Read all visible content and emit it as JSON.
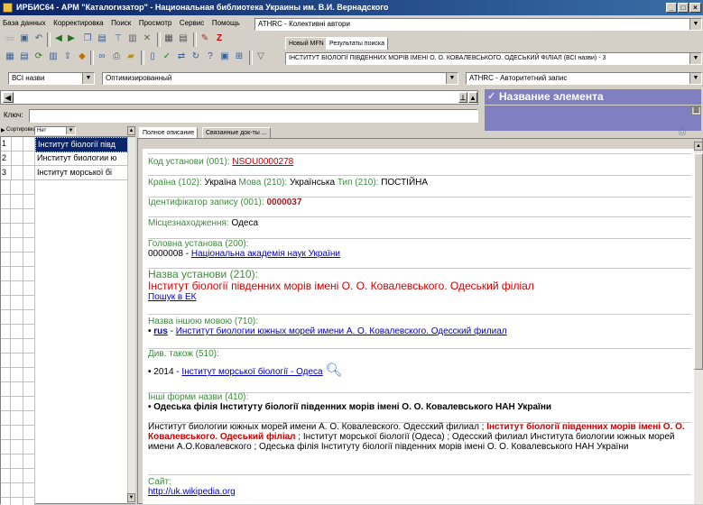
{
  "window": {
    "title": "ИРБИС64 - АРМ \"Каталогизатор\" - Национальная библиотека Украины им. В.И. Вернадского",
    "controls": [
      "_",
      "□",
      "×"
    ]
  },
  "menu": [
    "База данных",
    "Корректировка",
    "Поиск",
    "Просмотр",
    "Сервис",
    "Помощь"
  ],
  "database_combo": "ATHRC - Колективні автори",
  "toolbar1_icons": [
    "new-doc-icon",
    "save-icon",
    "undo-icon",
    "back-icon",
    "forward-icon",
    "copy-icon",
    "paste-icon",
    "filter-icon",
    "delete-icon",
    "cut-icon",
    "add-icon",
    "close-red-icon"
  ],
  "tabs_top": [
    "Новый MFN",
    "Результаты поиска"
  ],
  "search_result_combo": "ІНСТИТУТ БІОЛОГІЇ ПІВДЕННИХ МОРІВ ІМЕНІ О. О. КОВАЛЕВСЬКОГО. ОДЕСЬКИЙ ФІЛІАЛ (ВСІ назви) - 3",
  "names_combo": "ВСІ назви",
  "mode_combo": "Оптимизированный",
  "worksheet_combo": "ATHRC - Авторитетний запис",
  "element_panel_title": "Название элемента",
  "key_label": "Ключ:",
  "key_value": "",
  "sort": {
    "label": "Сортировка",
    "value": "Нет"
  },
  "grid_rows": [
    {
      "n": "1",
      "name": "Інститут біології півд"
    },
    {
      "n": "2",
      "name": "Институт биологии ю"
    },
    {
      "n": "3",
      "name": "Інститут морської бі"
    }
  ],
  "content_tabs": [
    "Полное описание",
    "Связанные док-ты ..."
  ],
  "record": {
    "code_label": "Код установи (001):",
    "code_value": "NSOU0000278",
    "country_label": "Країна (102):",
    "country_value": "Україна",
    "lang_label": "Мова (210):",
    "lang_value": "Українська",
    "type_label": "Тип (210):",
    "type_value": "ПОСТІЙНА",
    "id_label": "Ідентифікатор запису (001):",
    "id_value": "0000037",
    "location_label": "Місцезнаходження:",
    "location_value": "Одеса",
    "parent_label": "Головна установа (200):",
    "parent_code": "0000008 - ",
    "parent_link": "Національна академія наук України",
    "name_label": "Назва установи (210):",
    "name_value": "Інститут біології південних морів імені О. О. Ковалевського. Одеський філіал",
    "search_link": "Пошук в ЕК",
    "other_lang_label": "Назва іншою мовою (710):",
    "other_lang_code": "rus",
    "other_lang_link": "Институт биологии южных морей имени А. О. Ковалевского. Одесский филиал",
    "see_also_label": "Див. також (510):",
    "see_also_year": "2014 - ",
    "see_also_link": "Інститут морської біології - Одеса",
    "other_forms_label": "Інші форми назви (410):",
    "other_forms_value": "Одеська філія Інституту біології південних морів імені О. О. Ковалевського НАН України",
    "summary_a": "Институт биологии южных морей имени А. О. Ковалевского. Одесский филиал ; ",
    "summary_b": "Інститут біології південних морів імені О. О. Ковалевського. Одеський філіал",
    "summary_c": " ; Інститут морської біології (Одеса) ; Одесский филиал Института биологии южных морей имени А.О.Ковалевского ; Одеська філія Інституту біології південних морів імені О. О. Ковалевського НАН України",
    "site_label": "Сайт:",
    "site_link": "http://uk.wikipedia.org"
  },
  "colors": {
    "label_green": "#3c8c3c",
    "red": "#d00000",
    "link": "#0000c0",
    "title_blue": "#0a246a",
    "panel_purple": "#8080c0"
  }
}
